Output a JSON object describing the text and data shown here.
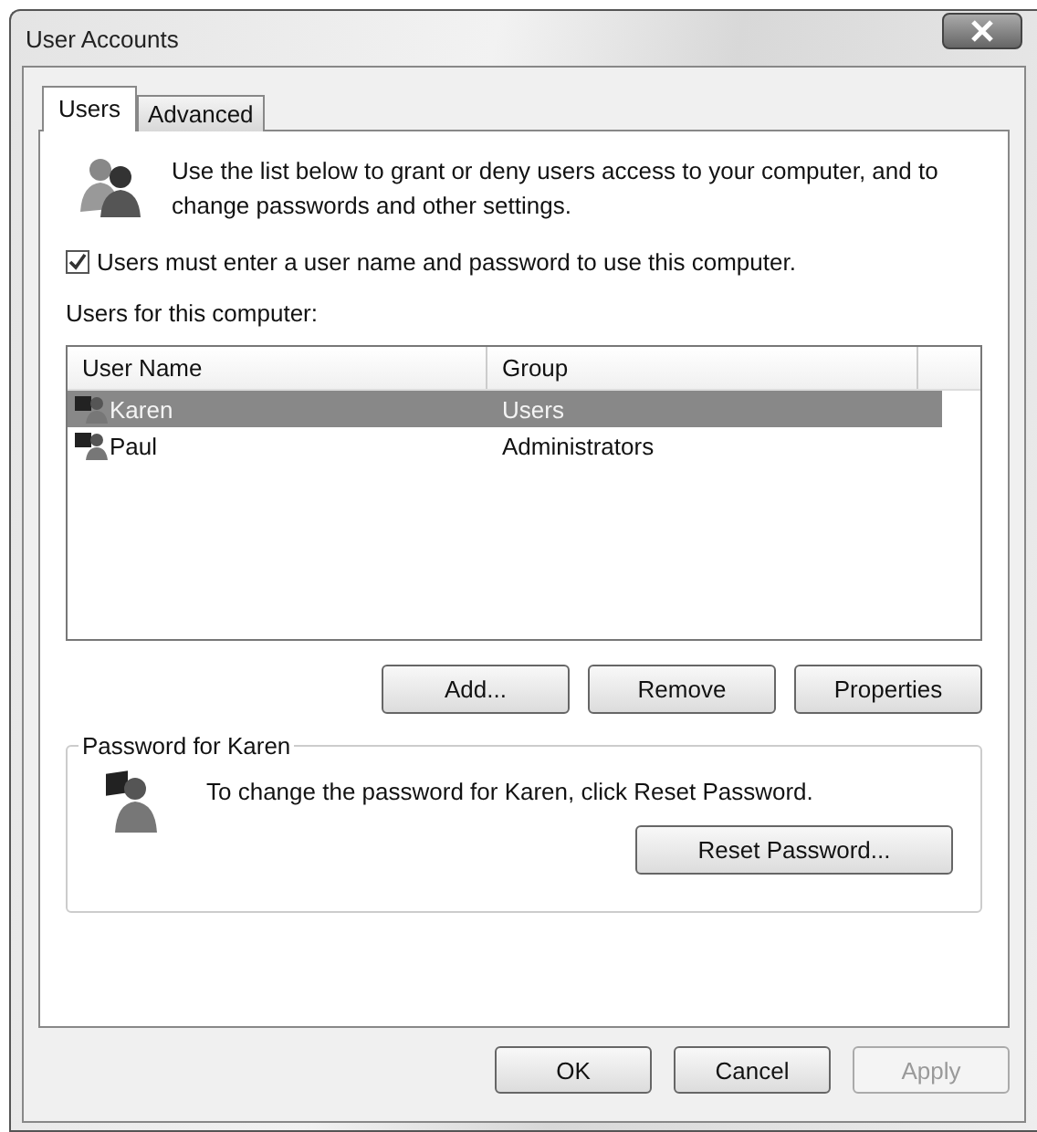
{
  "window": {
    "title": "User Accounts"
  },
  "tabs": [
    {
      "label": "Users",
      "selected": true
    },
    {
      "label": "Advanced",
      "selected": false
    }
  ],
  "intro": "Use the list below to grant or deny users access to your computer, and to change passwords and other settings.",
  "require_login": {
    "label": "Users must enter a user name and password to use this computer.",
    "checked": true
  },
  "users_label": "Users for this computer:",
  "table": {
    "columns": [
      "User Name",
      "Group"
    ],
    "rows": [
      {
        "name": "Karen",
        "group": "Users",
        "selected": true
      },
      {
        "name": "Paul",
        "group": "Administrators",
        "selected": false
      }
    ]
  },
  "list_buttons": [
    "Add...",
    "Remove",
    "Properties"
  ],
  "password_group": {
    "title": "Password for Karen",
    "text": "To change the password for Karen, click Reset Password.",
    "button": "Reset Password..."
  },
  "footer_buttons": [
    {
      "label": "OK",
      "disabled": false
    },
    {
      "label": "Cancel",
      "disabled": false
    },
    {
      "label": "Apply",
      "disabled": true
    }
  ]
}
